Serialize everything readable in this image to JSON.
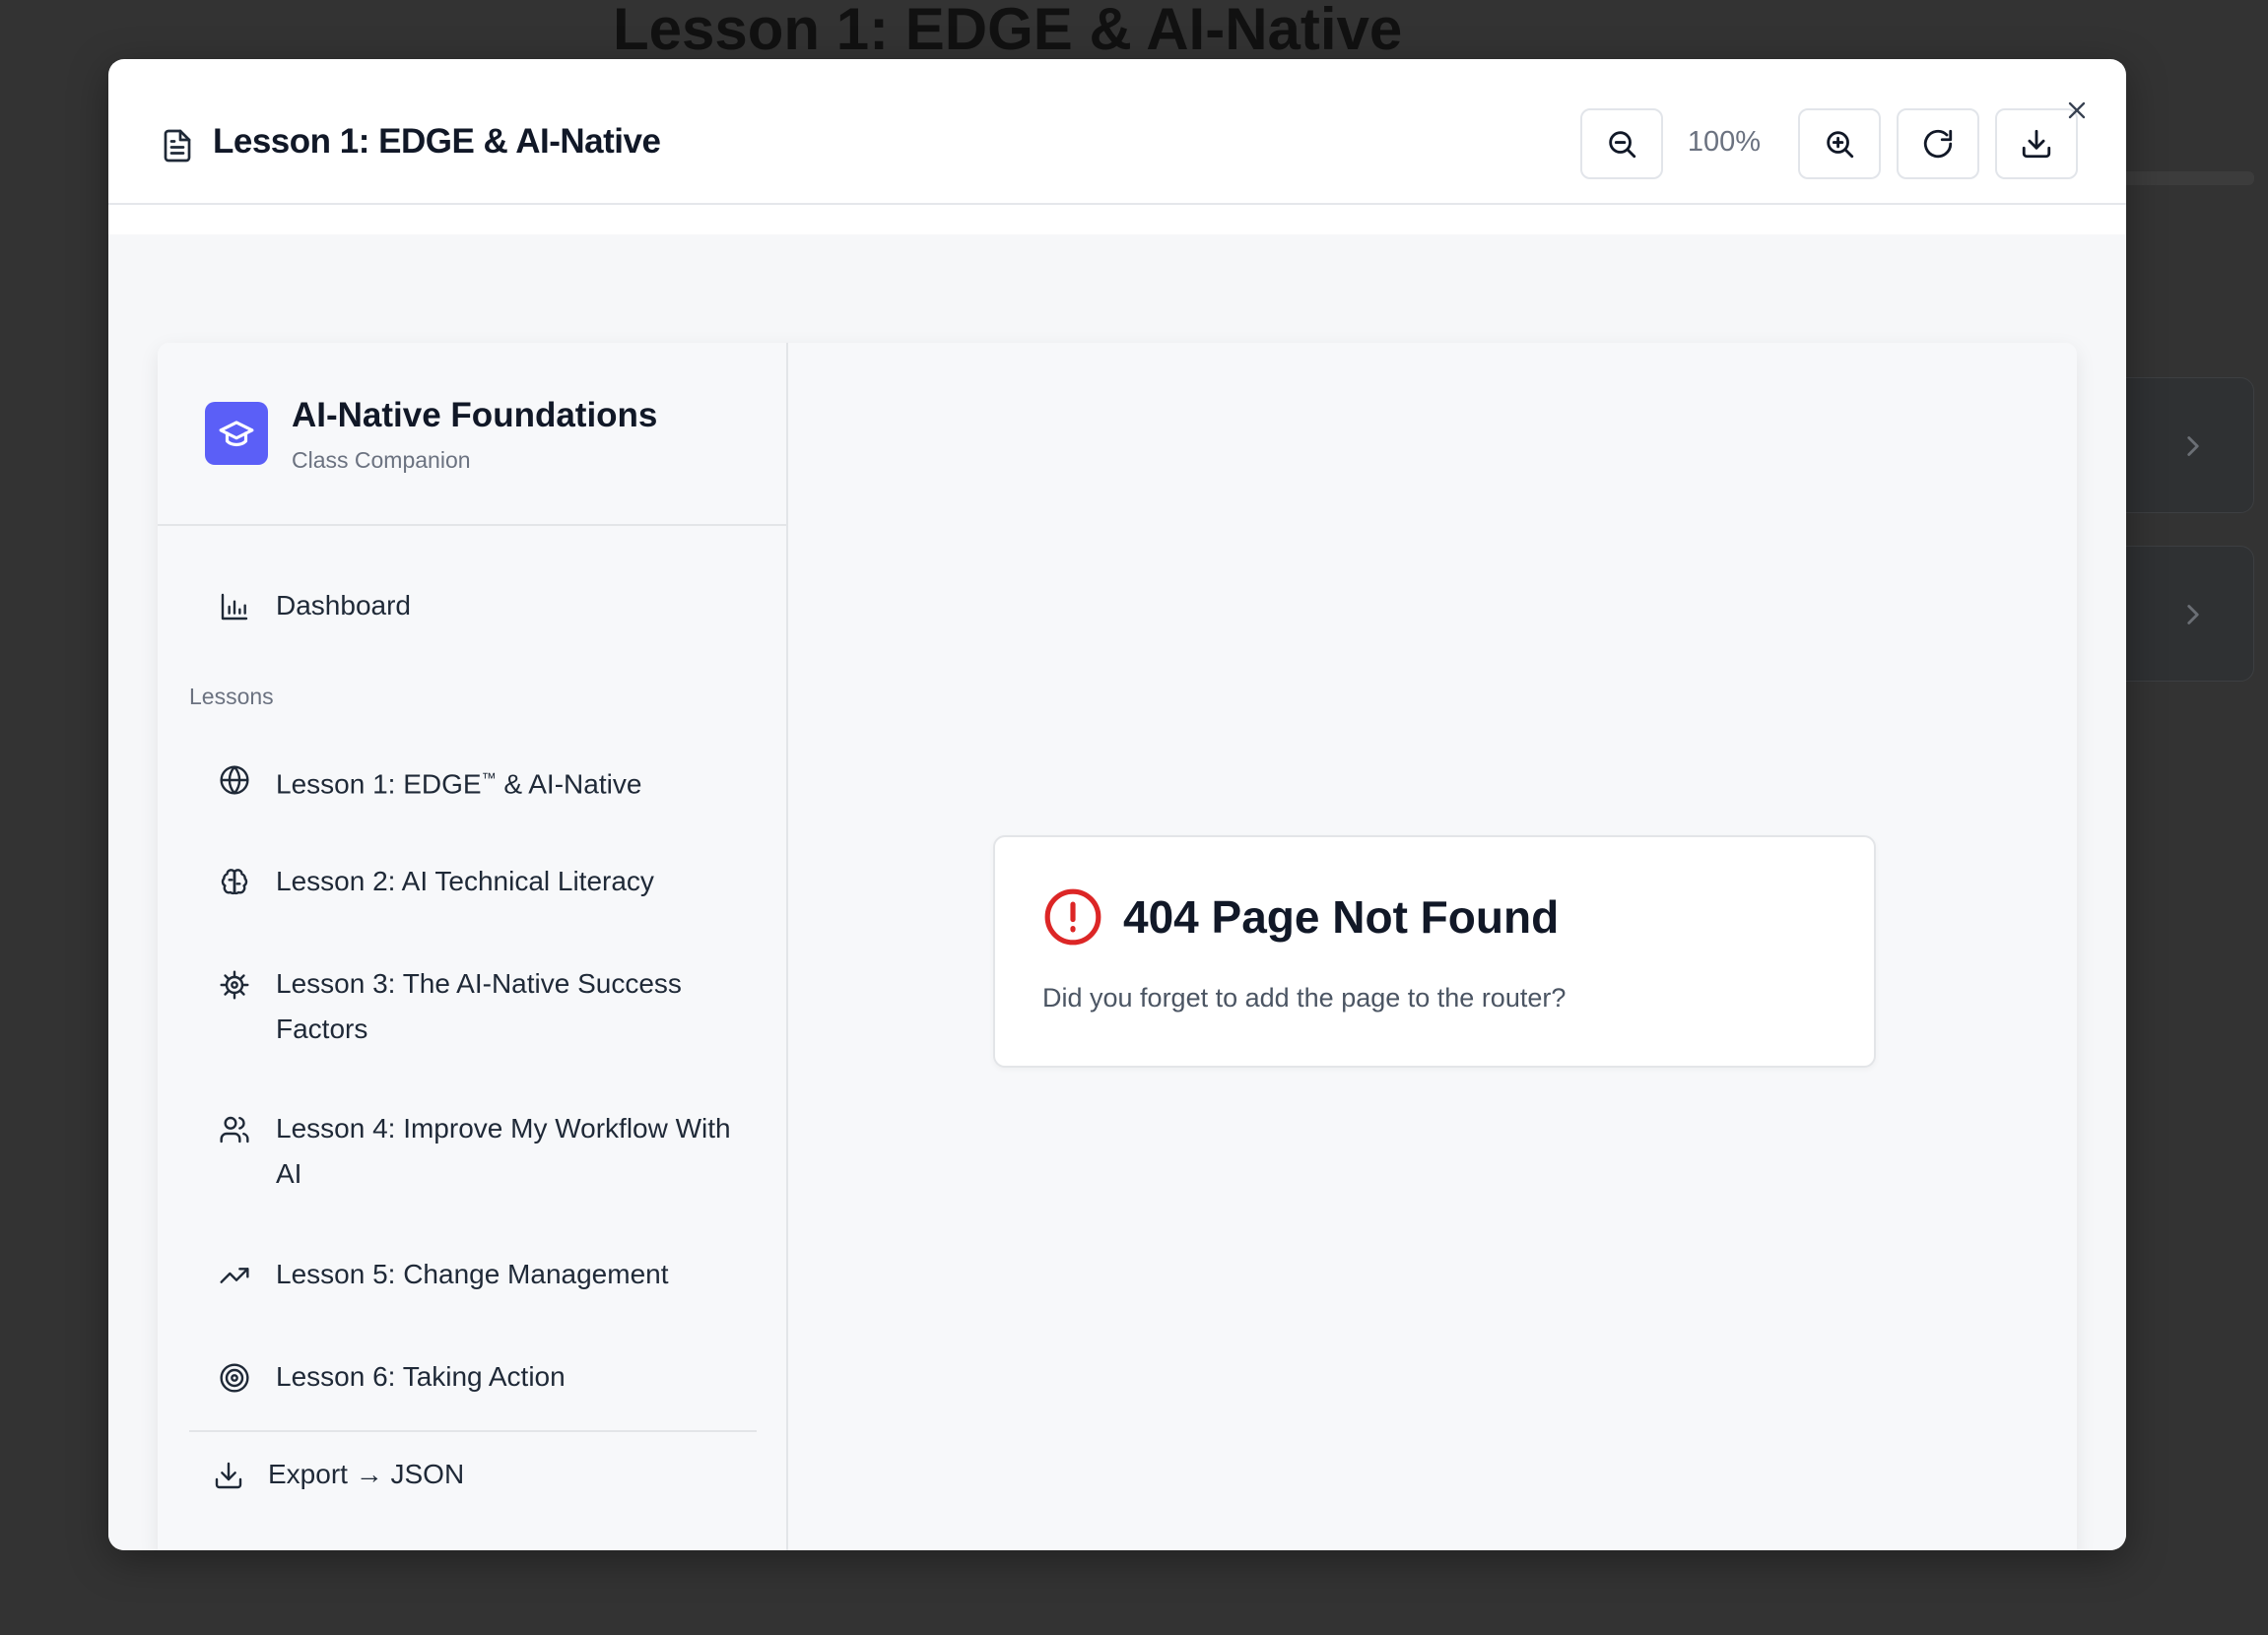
{
  "background": {
    "page_title": "Lesson 1: EDGE & AI-Native"
  },
  "modal": {
    "title": "Lesson 1: EDGE & AI-Native",
    "title_icon": "document-icon",
    "toolbar": {
      "zoom_out_icon": "zoom-out-icon",
      "zoom_level": "100%",
      "zoom_in_icon": "zoom-in-icon",
      "reset_icon": "rotate-cw-icon",
      "download_icon": "download-icon"
    },
    "close_icon": "close-icon"
  },
  "app": {
    "brand": {
      "name": "AI-Native Foundations",
      "subtitle": "Class Companion",
      "logo_icon": "graduation-cap-icon",
      "logo_color": "#5b5ff7"
    },
    "sidebar": {
      "dashboard": {
        "label": "Dashboard",
        "icon": "bar-chart-icon"
      },
      "section_label": "Lessons",
      "lessons": [
        {
          "label_prefix": "Lesson 1: EDGE",
          "label_tm": "™",
          "label_suffix": " & AI-Native",
          "icon": "globe-icon"
        },
        {
          "label": "Lesson 2: AI Technical Literacy",
          "icon": "brain-icon"
        },
        {
          "label": "Lesson 3: The AI-Native Success Factors",
          "icon": "cog-icon"
        },
        {
          "label": "Lesson 4: Improve My Workflow With AI",
          "icon": "users-icon"
        },
        {
          "label": "Lesson 5: Change Management",
          "icon": "trending-up-icon"
        },
        {
          "label": "Lesson 6: Taking Action",
          "icon": "target-icon"
        }
      ],
      "export": {
        "label": "Export → JSON",
        "icon": "download-icon"
      }
    },
    "main": {
      "error_title": "404 Page Not Found",
      "error_message": "Did you forget to add the page to the router?",
      "error_icon": "alert-circle-icon",
      "error_color": "#dc2626"
    }
  }
}
